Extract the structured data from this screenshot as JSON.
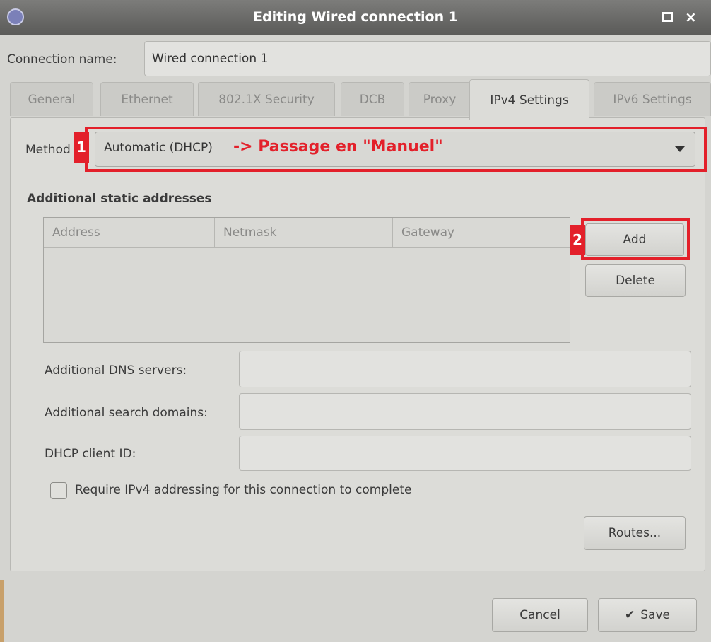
{
  "window": {
    "title": "Editing Wired connection 1",
    "maximize_glyph": "",
    "close_glyph": "×"
  },
  "connection_name": {
    "label": "Connection name:",
    "value": "Wired connection 1"
  },
  "tabs": [
    {
      "label": "General",
      "active": false
    },
    {
      "label": "Ethernet",
      "active": false
    },
    {
      "label": "802.1X Security",
      "active": false
    },
    {
      "label": "DCB",
      "active": false
    },
    {
      "label": "Proxy",
      "active": false
    },
    {
      "label": "IPv4 Settings",
      "active": true
    },
    {
      "label": "IPv6 Settings",
      "active": false
    }
  ],
  "ipv4": {
    "method_label": "Method",
    "method_value": "Automatic (DHCP)",
    "section_title": "Additional static addresses",
    "columns": [
      "Address",
      "Netmask",
      "Gateway"
    ],
    "add_label": "Add",
    "delete_label": "Delete",
    "dns_label": "Additional DNS servers:",
    "dns_value": "",
    "search_label": "Additional search domains:",
    "search_value": "",
    "dhcp_label": "DHCP client ID:",
    "dhcp_value": "",
    "require_label": "Require IPv4 addressing for this connection to complete",
    "require_checked": false,
    "routes_label": "Routes..."
  },
  "footer": {
    "cancel_label": "Cancel",
    "save_label": "Save",
    "save_icon": "✔"
  },
  "annotations": {
    "marker_1": "1",
    "marker_2": "2",
    "method_note": "-> Passage en \"Manuel\"",
    "color": "#e3202a"
  }
}
